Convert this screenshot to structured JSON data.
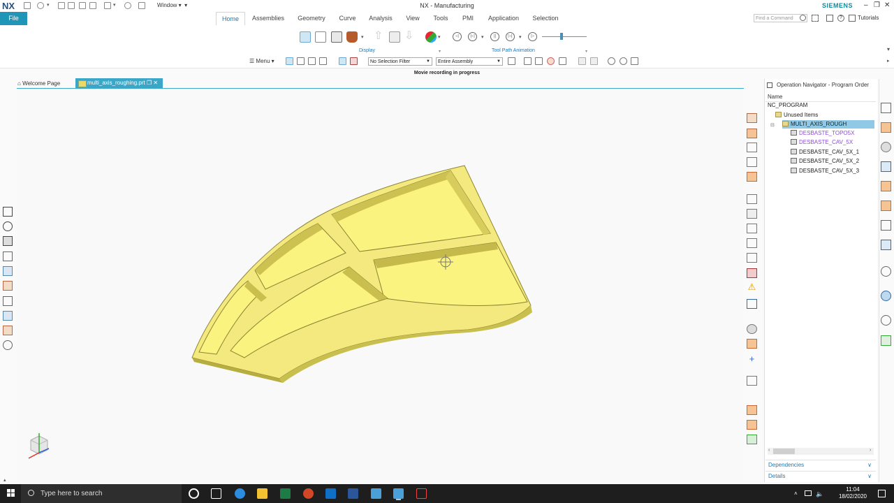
{
  "app": {
    "logo": "NX",
    "title": "NX - Manufacturing",
    "brand": "SIEMENS",
    "window_menu": "Window",
    "command_finder_placeholder": "Find a Command",
    "tutorials_label": "Tutorials"
  },
  "ribbon": {
    "file_tab": "File",
    "tabs": [
      "Home",
      "Assemblies",
      "Geometry",
      "Curve",
      "Analysis",
      "View",
      "Tools",
      "PMI",
      "Application",
      "Selection"
    ],
    "active_tab": "Home",
    "groups": [
      "Display",
      "Tool Path Animation"
    ]
  },
  "selection_bar": {
    "menu_label": "Menu",
    "filter_value": "No Selection Filter",
    "scope_value": "Entire Assembly"
  },
  "status": "Movie recording in progress",
  "graphics": {
    "tabs": [
      "Welcome Page",
      "multi_axis_roughing.prt"
    ],
    "active_tab": "multi_axis_roughing.prt"
  },
  "navigator": {
    "title": "Operation Navigator - Program Order",
    "column_header": "Name",
    "items": [
      {
        "label": "NC_PROGRAM",
        "level": 0,
        "kind": "root"
      },
      {
        "label": "Unused Items",
        "level": 1,
        "kind": "folder"
      },
      {
        "label": "MULTI_AXIS_ROUGH",
        "level": 2,
        "kind": "folder",
        "selected": true
      },
      {
        "label": "DESBASTE_TOPO5X",
        "level": 3,
        "kind": "operation",
        "state": "purple"
      },
      {
        "label": "DESBASTE_CAV_5X",
        "level": 3,
        "kind": "operation",
        "state": "purple"
      },
      {
        "label": "DESBASTE_CAV_5X_1",
        "level": 3,
        "kind": "operation"
      },
      {
        "label": "DESBASTE_CAV_5X_2",
        "level": 3,
        "kind": "operation"
      },
      {
        "label": "DESBASTE_CAV_5X_3",
        "level": 3,
        "kind": "operation"
      }
    ],
    "panels": [
      "Dependencies",
      "Details"
    ]
  },
  "taskbar": {
    "search_placeholder": "Type here to search",
    "time": "11:04",
    "date": "18/02/2020"
  },
  "colors": {
    "accent": "#1f95b8",
    "part": "#f5ec86",
    "part_shadow": "#c9bf4e",
    "selection": "#8fc9e5",
    "taskbar": "#1e1e1e"
  }
}
